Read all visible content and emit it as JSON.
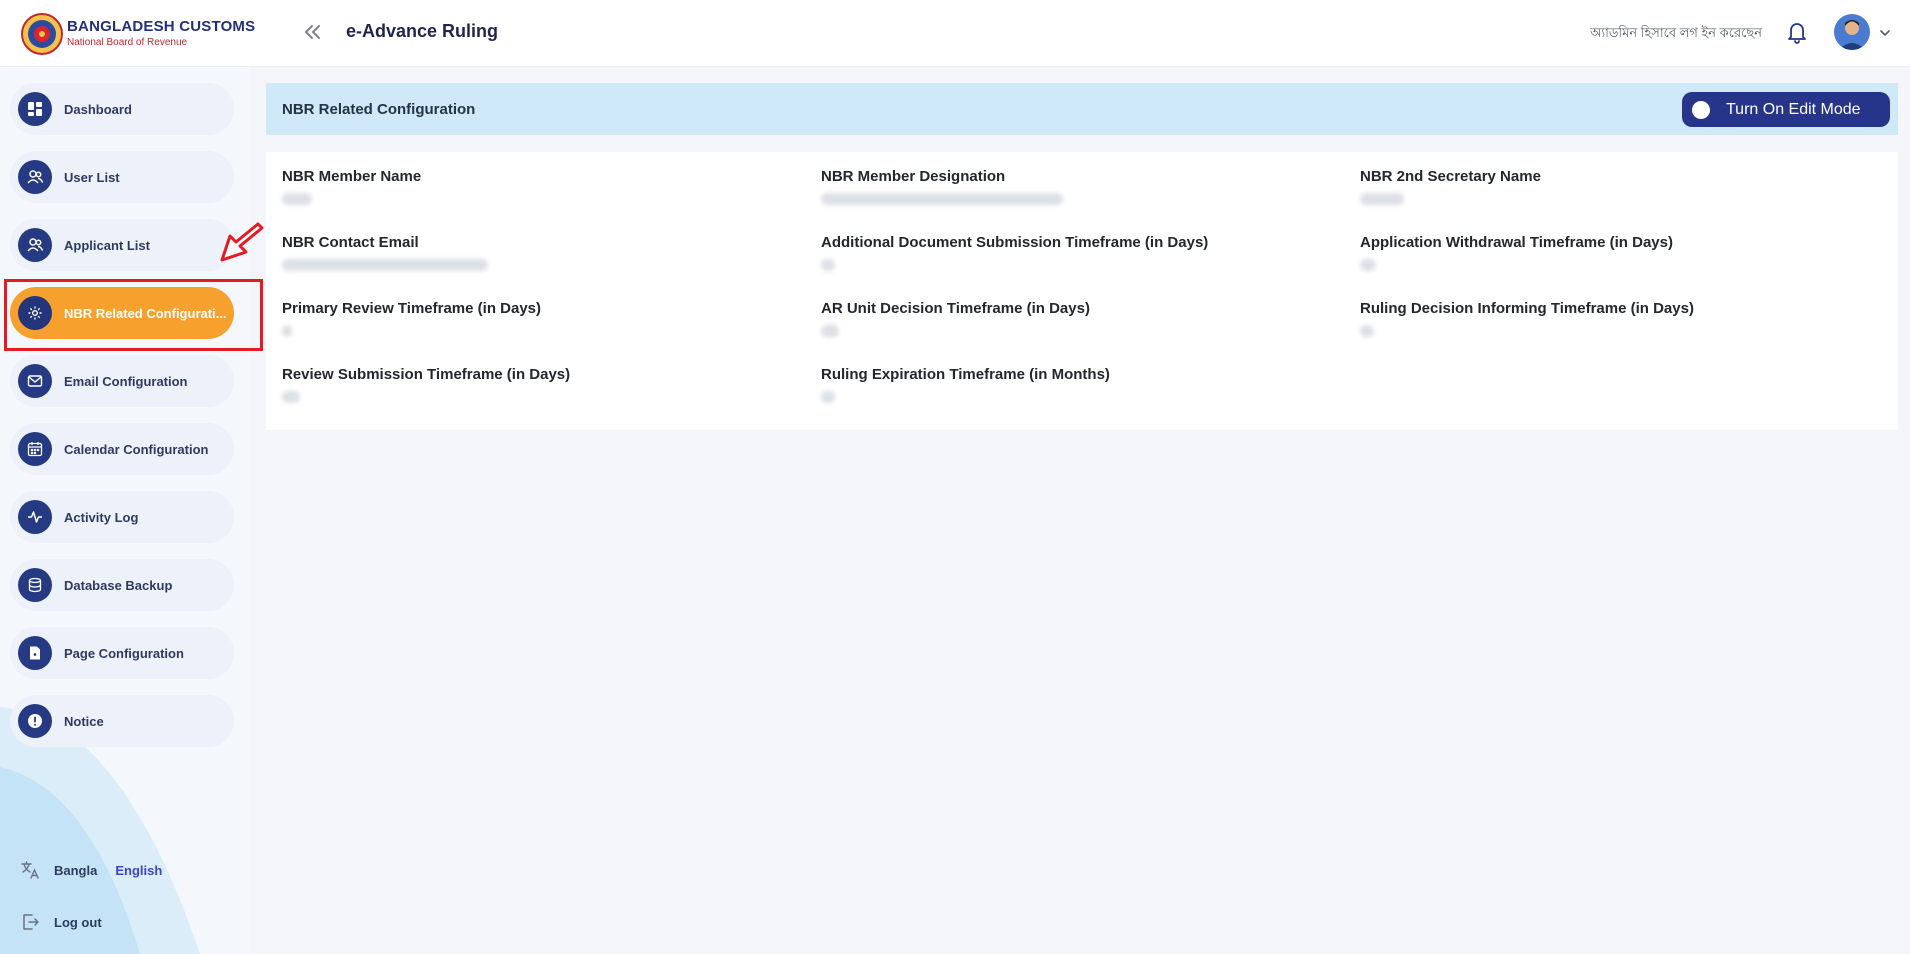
{
  "header": {
    "brand_title": "BANGLADESH CUSTOMS",
    "brand_subtitle": "National Board of Revenue",
    "app_title": "e-Advance Ruling",
    "login_status": "অ্যাডমিন হিসাবে লগ ইন করেছেন"
  },
  "sidebar": {
    "items": [
      {
        "label": "Dashboard",
        "icon": "dashboard-icon"
      },
      {
        "label": "User List",
        "icon": "users-icon"
      },
      {
        "label": "Applicant List",
        "icon": "users-icon"
      },
      {
        "label": "NBR Related Configurati...",
        "icon": "gear-icon",
        "active": true
      },
      {
        "label": "Email Configuration",
        "icon": "mail-icon"
      },
      {
        "label": "Calendar Configuration",
        "icon": "calendar-icon"
      },
      {
        "label": "Activity Log",
        "icon": "activity-icon"
      },
      {
        "label": "Database Backup",
        "icon": "database-icon"
      },
      {
        "label": "Page Configuration",
        "icon": "page-settings-icon"
      },
      {
        "label": "Notice",
        "icon": "alert-icon"
      }
    ],
    "lang_bangla": "Bangla",
    "lang_english": "English",
    "logout": "Log out"
  },
  "main": {
    "section_title": "NBR Related Configuration",
    "edit_button": "Turn On Edit Mode",
    "fields": [
      {
        "label": "NBR Member Name"
      },
      {
        "label": "NBR Member Designation"
      },
      {
        "label": "NBR 2nd Secretary Name"
      },
      {
        "label": "NBR Contact Email"
      },
      {
        "label": "Additional Document Submission Timeframe (in Days)"
      },
      {
        "label": "Application Withdrawal Timeframe (in Days)"
      },
      {
        "label": "Primary Review Timeframe (in Days)"
      },
      {
        "label": "AR Unit Decision Timeframe (in Days)"
      },
      {
        "label": "Ruling Decision Informing Timeframe (in Days)"
      },
      {
        "label": "Review Submission Timeframe (in Days)"
      },
      {
        "label": "Ruling Expiration Timeframe (in Months)"
      }
    ]
  },
  "colors": {
    "accent": "#26358a",
    "active_nav": "#f6a12d",
    "section_header": "#cfe9f8",
    "annotation": "#e41b22"
  }
}
